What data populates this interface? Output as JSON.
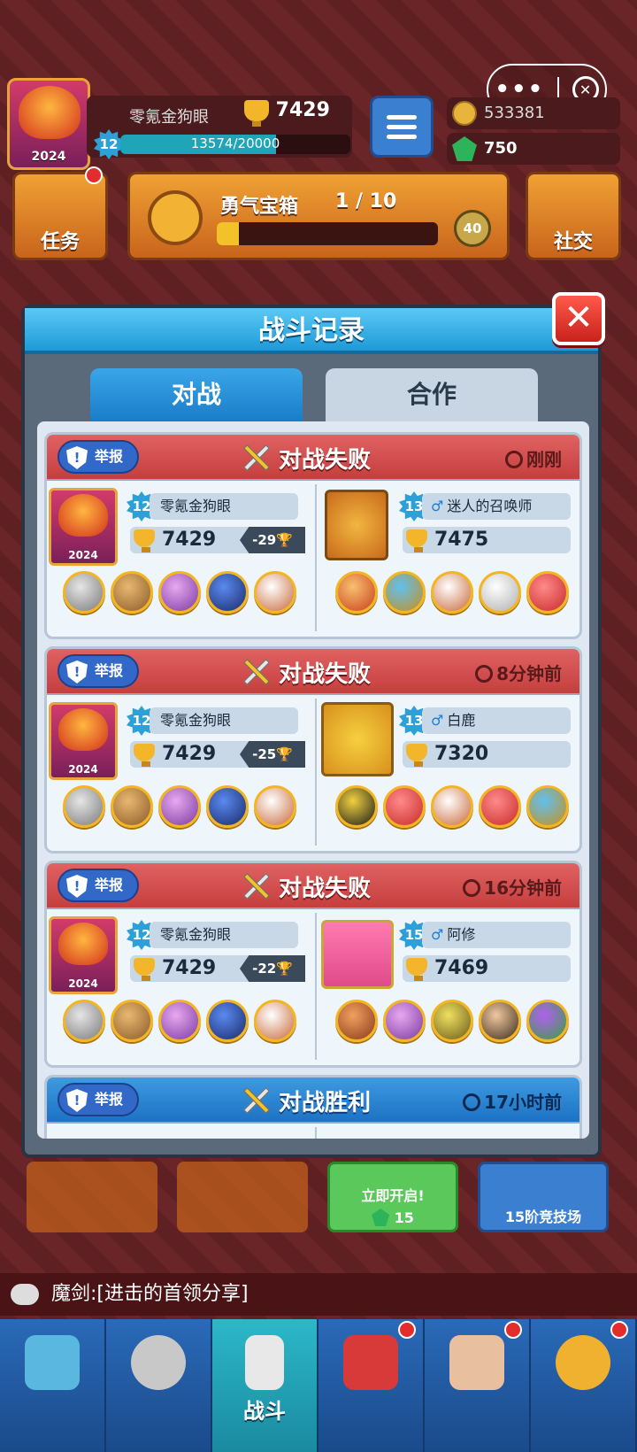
{
  "topbar": {
    "player_name": "零氪金狗眼",
    "trophies": "7429",
    "level": "12",
    "xp_text": "13574/20000",
    "xp_fraction": 0.6787,
    "coins": "533381",
    "gems": "750",
    "avatar_year": "2024"
  },
  "buttons": {
    "tasks": "任务",
    "social": "社交"
  },
  "chest": {
    "title": "勇气宝箱",
    "count": "1 / 10",
    "progress_fraction": 0.1,
    "coin_value": "40"
  },
  "modal": {
    "title": "战斗记录",
    "close": "✕",
    "tabs": [
      "对战",
      "合作"
    ]
  },
  "battles": [
    {
      "report": "举报",
      "result": "对战失败",
      "outcome": "lose",
      "time": "刚刚",
      "me": {
        "level": "12",
        "name": "零氪金狗眼",
        "trophies": "7429",
        "delta": "-29",
        "year": "2024"
      },
      "opp": {
        "level": "13",
        "name": "迷人的召唤师",
        "trophies": "7475"
      }
    },
    {
      "report": "举报",
      "result": "对战失败",
      "outcome": "lose",
      "time": "8分钟前",
      "me": {
        "level": "12",
        "name": "零氪金狗眼",
        "trophies": "7429",
        "delta": "-25",
        "year": "2024"
      },
      "opp": {
        "level": "13",
        "name": "白鹿",
        "trophies": "7320"
      }
    },
    {
      "report": "举报",
      "result": "对战失败",
      "outcome": "lose",
      "time": "16分钟前",
      "me": {
        "level": "12",
        "name": "零氪金狗眼",
        "trophies": "7429",
        "delta": "-22",
        "year": "2024"
      },
      "opp": {
        "level": "15",
        "name": "阿修",
        "trophies": "7469"
      }
    },
    {
      "report": "举报",
      "result": "对战胜利",
      "outcome": "win",
      "time": "17小时前"
    }
  ],
  "bottom": {
    "open_now": "立即开启!",
    "open_cost": "15",
    "arena": "15阶竞技场",
    "chat_text": "魔剑:[进击的首领分享]",
    "nav_active": "战斗"
  }
}
